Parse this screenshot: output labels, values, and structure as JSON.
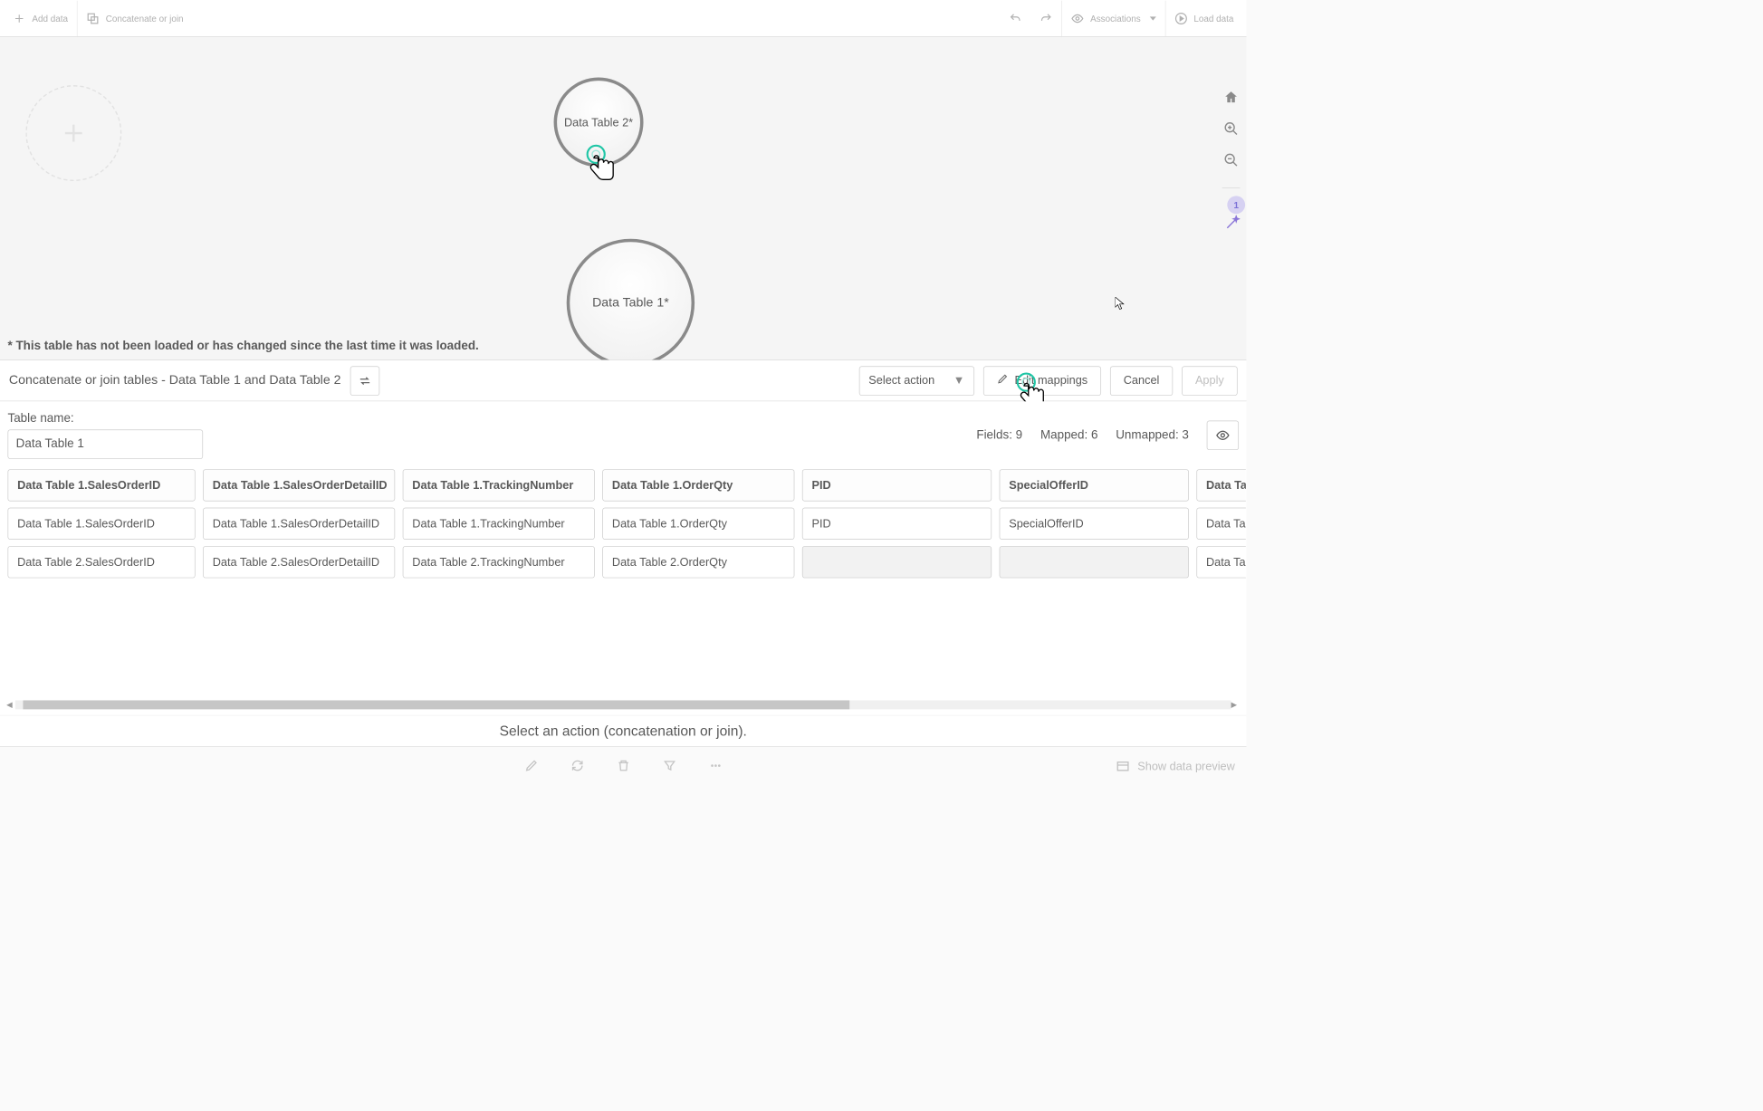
{
  "toolbar": {
    "add_data": "Add data",
    "concat_join": "Concatenate or join",
    "associations": "Associations",
    "load_data": "Load data"
  },
  "canvas": {
    "bubble_small": "Data Table 2*",
    "bubble_large": "Data Table 1*",
    "note": "* This table has not been loaded or has changed since the last time it was loaded.",
    "badge": "1"
  },
  "action_bar": {
    "title": "Concatenate or join tables - Data Table 1 and Data Table 2",
    "select_action": "Select action",
    "edit_mappings": "Edit mappings",
    "cancel": "Cancel",
    "apply": "Apply"
  },
  "panel": {
    "table_name_label": "Table name:",
    "table_name_value": "Data Table 1",
    "fields_label": "Fields:",
    "fields_value": "9",
    "mapped_label": "Mapped:",
    "mapped_value": "6",
    "unmapped_label": "Unmapped:",
    "unmapped_value": "3",
    "columns": [
      {
        "header": "Data Table 1.SalesOrderID",
        "rows": [
          "Data Table 1.SalesOrderID",
          "Data Table 2.SalesOrderID"
        ]
      },
      {
        "header": "Data Table 1.SalesOrderDetailID",
        "rows": [
          "Data Table 1.SalesOrderDetailID",
          "Data Table 2.SalesOrderDetailID"
        ]
      },
      {
        "header": "Data Table 1.TrackingNumber",
        "rows": [
          "Data Table 1.TrackingNumber",
          "Data Table 2.TrackingNumber"
        ]
      },
      {
        "header": "Data Table 1.OrderQty",
        "rows": [
          "Data Table 1.OrderQty",
          "Data Table 2.OrderQty"
        ]
      },
      {
        "header": "PID",
        "rows": [
          "PID",
          ""
        ]
      },
      {
        "header": "SpecialOfferID",
        "rows": [
          "SpecialOfferID",
          ""
        ]
      },
      {
        "header": "Data Ta",
        "rows": [
          "Data Ta",
          "Data Ta"
        ]
      }
    ]
  },
  "footer": {
    "message": "Select an action (concatenation or join).",
    "show_preview": "Show data preview"
  }
}
